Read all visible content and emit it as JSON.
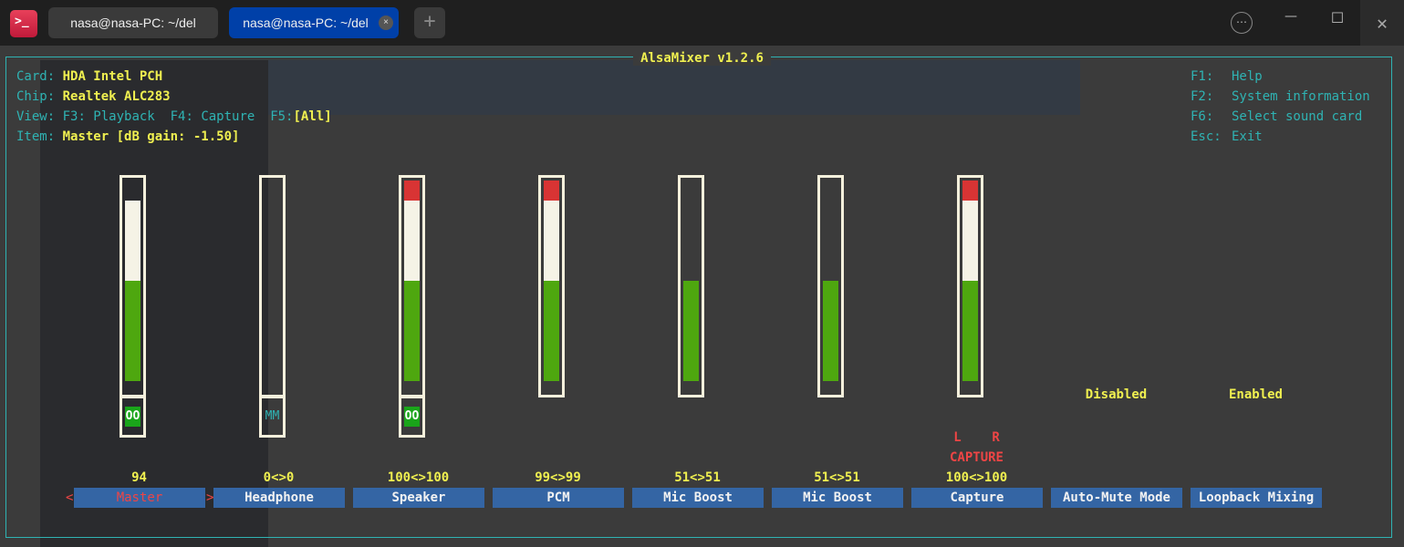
{
  "window": {
    "tabs": [
      {
        "label": "nasa@nasa-PC: ~/del"
      },
      {
        "label": "nasa@nasa-PC: ~/del",
        "active": true
      }
    ],
    "new_tab": "+",
    "close_tab": "×",
    "more": "⋯",
    "minimize": "—",
    "maximize": "☐",
    "close": "✕"
  },
  "mixer": {
    "title": "AlsaMixer v1.2.6",
    "card_label": "Card:",
    "card": "HDA Intel PCH",
    "chip_label": "Chip:",
    "chip": "Realtek ALC283",
    "view_label": "View:",
    "view_f3": "F3: Playback",
    "view_f4": "F4: Capture",
    "view_f5": "F5:",
    "view_active": "[All]",
    "item_label": "Item:",
    "item": "Master [dB gain: -1.50]",
    "help": [
      {
        "key": "F1:",
        "text": "Help"
      },
      {
        "key": "F2:",
        "text": "System information"
      },
      {
        "key": "F6:",
        "text": "Select sound card"
      },
      {
        "key": "Esc:",
        "text": "Exit"
      }
    ],
    "capture_lr": "L    R",
    "capture_flag": "CAPTURE",
    "controls": [
      {
        "name": "Master",
        "value": "94",
        "level": 94,
        "switch": "OO",
        "switch_on": true,
        "selected": true
      },
      {
        "name": "Headphone",
        "value": "0<>0",
        "level": 0,
        "switch": "MM",
        "switch_on": false
      },
      {
        "name": "Speaker",
        "value": "100<>100",
        "level": 100,
        "switch": "OO",
        "switch_on": true
      },
      {
        "name": "PCM",
        "value": "99<>99",
        "level": 99
      },
      {
        "name": "Mic Boost",
        "value": "51<>51",
        "level": 51
      },
      {
        "name": "Mic Boost",
        "value": "51<>51",
        "level": 51
      },
      {
        "name": "Capture",
        "value": "100<>100",
        "level": 100,
        "capture": true
      },
      {
        "name": "Auto-Mute Mode",
        "enum": "Disabled"
      },
      {
        "name": "Loopback Mixing",
        "enum": "Enabled"
      }
    ],
    "colors": {
      "low": "#4ea70f",
      "mid": "#f5f3e6",
      "high": "#d83434",
      "frame": "#2fb3b3"
    }
  }
}
